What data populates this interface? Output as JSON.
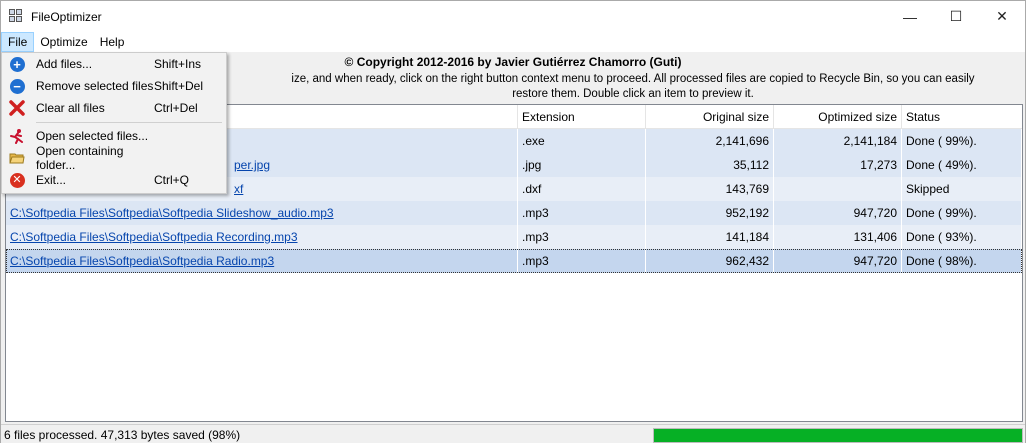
{
  "window": {
    "title": "FileOptimizer"
  },
  "window_controls": {
    "minimize": "—",
    "maximize": "☐",
    "close": "✕"
  },
  "menubar": {
    "file": "File",
    "optimize": "Optimize",
    "help": "Help"
  },
  "header": {
    "copyright": "© Copyright 2012-2016 by Javier Gutiérrez Chamorro (Guti)",
    "instructions": "ize, and when ready, click on the right button context menu to proceed. All processed files are copied to Recycle Bin, so you can easily restore them. Double click an item to preview it."
  },
  "table": {
    "columns": {
      "name": "",
      "extension": "Extension",
      "original": "Original size",
      "optimized": "Optimized size",
      "status": "Status"
    },
    "rows": [
      {
        "name": "",
        "extension": ".exe",
        "original": "2,141,696",
        "optimized": "2,141,184",
        "status": "Done ( 99%)."
      },
      {
        "name": "per.jpg",
        "extension": ".jpg",
        "original": "35,112",
        "optimized": "17,273",
        "status": "Done ( 49%)."
      },
      {
        "name": "xf",
        "extension": ".dxf",
        "original": "143,769",
        "optimized": "",
        "status": "Skipped"
      },
      {
        "name": "C:\\Softpedia Files\\Softpedia\\Softpedia Slideshow_audio.mp3",
        "extension": ".mp3",
        "original": "952,192",
        "optimized": "947,720",
        "status": "Done ( 99%)."
      },
      {
        "name": "C:\\Softpedia Files\\Softpedia\\Softpedia Recording.mp3",
        "extension": ".mp3",
        "original": "141,184",
        "optimized": "131,406",
        "status": "Done ( 93%)."
      },
      {
        "name": "C:\\Softpedia Files\\Softpedia\\Softpedia Radio.mp3",
        "extension": ".mp3",
        "original": "962,432",
        "optimized": "947,720",
        "status": "Done ( 98%)."
      }
    ]
  },
  "file_menu": {
    "add": {
      "label": "Add files...",
      "shortcut": "Shift+Ins"
    },
    "remove": {
      "label": "Remove selected files",
      "shortcut": "Shift+Del"
    },
    "clear": {
      "label": "Clear all files",
      "shortcut": "Ctrl+Del"
    },
    "open_selected": {
      "label": "Open selected files...",
      "shortcut": ""
    },
    "open_folder": {
      "label": "Open containing folder...",
      "shortcut": ""
    },
    "exit": {
      "label": "Exit...",
      "shortcut": "Ctrl+Q"
    }
  },
  "icons": {
    "add": "plus-circle-icon",
    "remove": "minus-circle-icon",
    "clear": "red-x-icon",
    "open_selected": "run-icon",
    "open_folder": "folder-icon",
    "exit": "exit-icon"
  },
  "statusbar": {
    "text": "6 files processed. 47,313 bytes saved (98%)",
    "progress": 1.0
  },
  "colors": {
    "progress": "#06b025",
    "selection": "#c4d6ee",
    "link": "#0645ad"
  }
}
